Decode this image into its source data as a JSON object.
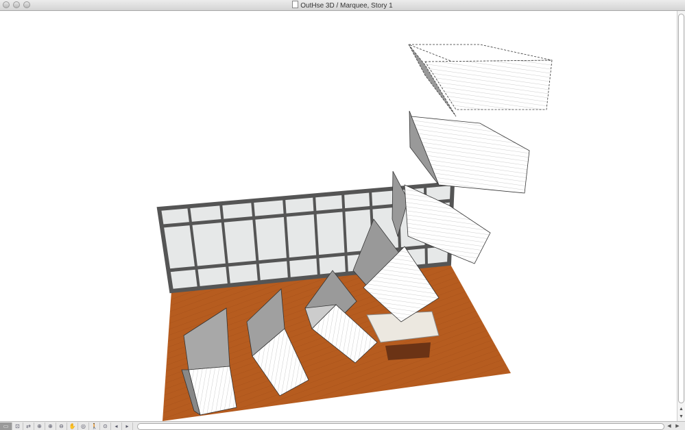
{
  "window": {
    "title": "OutHse 3D / Marquee, Story 1"
  },
  "toolbar": {
    "tools": [
      {
        "name": "view-mode-button",
        "glyph": "▭"
      },
      {
        "name": "zoom-area-icon",
        "glyph": "⊡"
      },
      {
        "name": "orbit-icon",
        "glyph": "⇄"
      },
      {
        "name": "zoom-fit-icon",
        "glyph": "⊕"
      },
      {
        "name": "zoom-in-icon",
        "glyph": "⊕"
      },
      {
        "name": "zoom-out-icon",
        "glyph": "⊖"
      },
      {
        "name": "pan-hand-icon",
        "glyph": "✋"
      },
      {
        "name": "explore-icon",
        "glyph": "◎"
      },
      {
        "name": "walk-icon",
        "glyph": "🚶"
      },
      {
        "name": "fit-in-window-icon",
        "glyph": "⊙"
      },
      {
        "name": "previous-zoom-icon",
        "glyph": "◂"
      },
      {
        "name": "next-zoom-icon",
        "glyph": "▸"
      }
    ]
  },
  "scroll": {
    "up": "▲",
    "down": "▼",
    "left": "◀",
    "right": "▶"
  },
  "colors": {
    "floor": "#b55a1e",
    "wall_frame": "#555555",
    "wall_panel": "#e6e8e8",
    "module": "#ffffff",
    "roof_shade": "#9a9a9a"
  }
}
